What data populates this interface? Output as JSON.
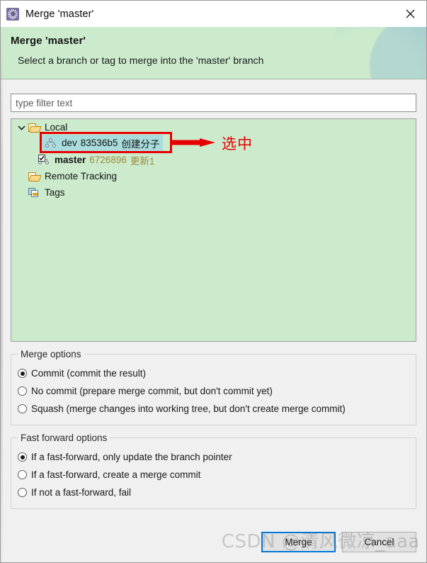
{
  "window": {
    "title": "Merge 'master'",
    "app_icon": "merge-icon",
    "close_icon": "close-icon"
  },
  "banner": {
    "title": "Merge 'master'",
    "subtitle": "Select a branch or tag to merge into the 'master' branch",
    "background_color": "#ccebcd"
  },
  "filter": {
    "placeholder": "type filter text",
    "value": ""
  },
  "tree": {
    "background_color": "#ccebcd",
    "selection_color": "#a9dcdc",
    "nodes": [
      {
        "label": "Local",
        "icon": "folder-open-icon",
        "expanded": true,
        "level": 0
      },
      {
        "label": "dev",
        "sha": "83536b5",
        "message": "创建分子",
        "icon": "git-branch-icon",
        "level": 1,
        "selected": true
      },
      {
        "label": "master",
        "sha": "6726896",
        "message": "更新1",
        "icon": "git-branch-checked-icon",
        "level": 1,
        "selected": false,
        "current": true
      },
      {
        "label": "Remote Tracking",
        "icon": "folder-open-icon",
        "expanded": false,
        "level": 0
      },
      {
        "label": "Tags",
        "icon": "tags-icon",
        "expanded": false,
        "level": 0
      }
    ]
  },
  "annotation": {
    "arrow_color": "#e60000",
    "box_color": "#e60000",
    "text": "选中"
  },
  "merge_options": {
    "legend": "Merge options",
    "items": [
      {
        "label": "Commit (commit the result)",
        "checked": true
      },
      {
        "label": "No commit (prepare merge commit, but don't commit yet)",
        "checked": false
      },
      {
        "label": "Squash (merge changes into working tree, but don't create merge commit)",
        "checked": false
      }
    ]
  },
  "fast_forward_options": {
    "legend": "Fast forward options",
    "items": [
      {
        "label": "If a fast-forward, only update the branch pointer",
        "checked": true
      },
      {
        "label": "If a fast-forward, create a merge commit",
        "checked": false
      },
      {
        "label": "If not a fast-forward, fail",
        "checked": false
      }
    ]
  },
  "buttons": {
    "merge": "Merge",
    "cancel": "Cancel"
  },
  "watermark": {
    "text": "CSDN @清风微凉_aaa"
  }
}
